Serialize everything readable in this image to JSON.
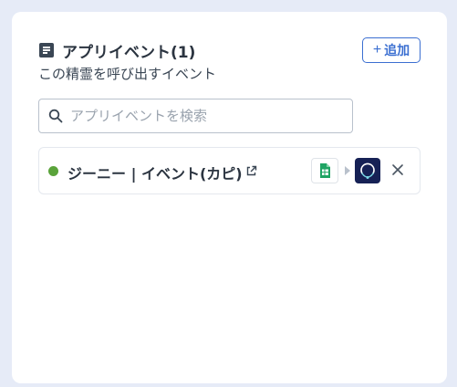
{
  "panel": {
    "title": "アプリイベント(1)",
    "subtitle": "この精霊を呼び出すイベント",
    "add_button_label": "追加",
    "add_button_icon": "plus-icon",
    "header_icon": "document-list-icon"
  },
  "search": {
    "placeholder": "アプリイベントを検索",
    "value": "",
    "icon": "search-icon"
  },
  "events": [
    {
      "title": "ジーニー | イベント(カピ)",
      "status_color": "#5aa33a",
      "link_icon": "external-link-icon",
      "source_app_icon": "google-sheets-icon",
      "flow_icon": "arrow-right-icon",
      "target_app_icon": "genie-app-icon",
      "remove_icon": "close-icon"
    }
  ],
  "colors": {
    "accent": "#3b6fd1",
    "status_active": "#5aa33a",
    "sheets_green": "#1fa463",
    "genie_navy": "#162155"
  }
}
